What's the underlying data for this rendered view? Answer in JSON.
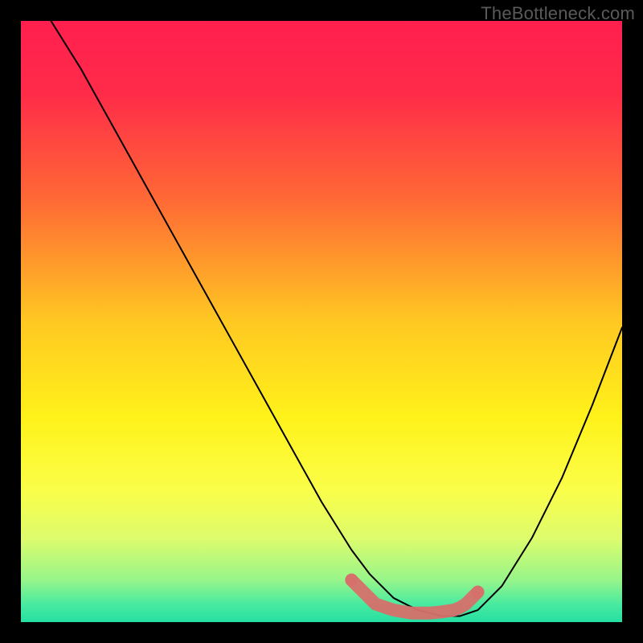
{
  "watermark": "TheBottleneck.com",
  "chart_data": {
    "type": "line",
    "title": "",
    "xlabel": "",
    "ylabel": "",
    "xlim": [
      0,
      100
    ],
    "ylim": [
      0,
      100
    ],
    "grid": false,
    "legend": false,
    "gradient_stops": [
      {
        "offset": 0.0,
        "color": "#ff1f4f"
      },
      {
        "offset": 0.12,
        "color": "#ff2b49"
      },
      {
        "offset": 0.3,
        "color": "#ff6a35"
      },
      {
        "offset": 0.5,
        "color": "#ffc822"
      },
      {
        "offset": 0.66,
        "color": "#fff21a"
      },
      {
        "offset": 0.78,
        "color": "#fafe49"
      },
      {
        "offset": 0.86,
        "color": "#defc6c"
      },
      {
        "offset": 0.93,
        "color": "#97f58a"
      },
      {
        "offset": 0.97,
        "color": "#49eaa0"
      },
      {
        "offset": 1.0,
        "color": "#25dfa2"
      }
    ],
    "series": [
      {
        "name": "bottleneck-curve",
        "color": "#000000",
        "x": [
          5,
          10,
          15,
          20,
          25,
          30,
          35,
          40,
          45,
          50,
          55,
          58,
          62,
          66,
          70,
          73,
          76,
          80,
          85,
          90,
          95,
          100
        ],
        "y": [
          100,
          92,
          83,
          74,
          65,
          56,
          47,
          38,
          29,
          20,
          12,
          8,
          4,
          2,
          1,
          1,
          2,
          6,
          14,
          24,
          36,
          49
        ]
      },
      {
        "name": "optimal-region",
        "color": "#d6706b",
        "x": [
          55,
          57,
          59,
          62,
          65,
          68,
          70,
          72,
          73,
          74,
          75,
          76
        ],
        "y": [
          7,
          5,
          3,
          2,
          1.5,
          1.5,
          1.7,
          2,
          2.4,
          3,
          4,
          5
        ]
      }
    ]
  }
}
